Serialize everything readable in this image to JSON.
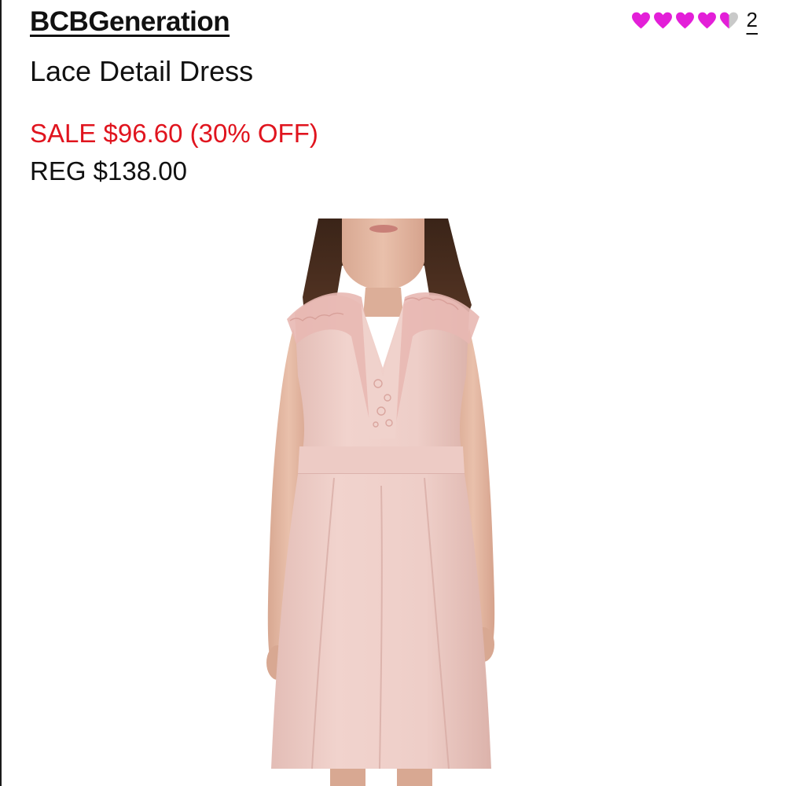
{
  "product": {
    "brand": "BCBGeneration",
    "name": "Lace Detail Dress",
    "sale_price": "SALE $96.60 (30% OFF)",
    "regular_price": "REG $138.00"
  },
  "rating": {
    "value": 4.5,
    "max": 5,
    "review_count": "2",
    "icon": "heart-icon",
    "filled_color": "#e31fd8",
    "empty_color": "#c9c9c9"
  },
  "colors": {
    "sale": "#e0141e",
    "text": "#111111",
    "dress": "#eeccc6"
  }
}
